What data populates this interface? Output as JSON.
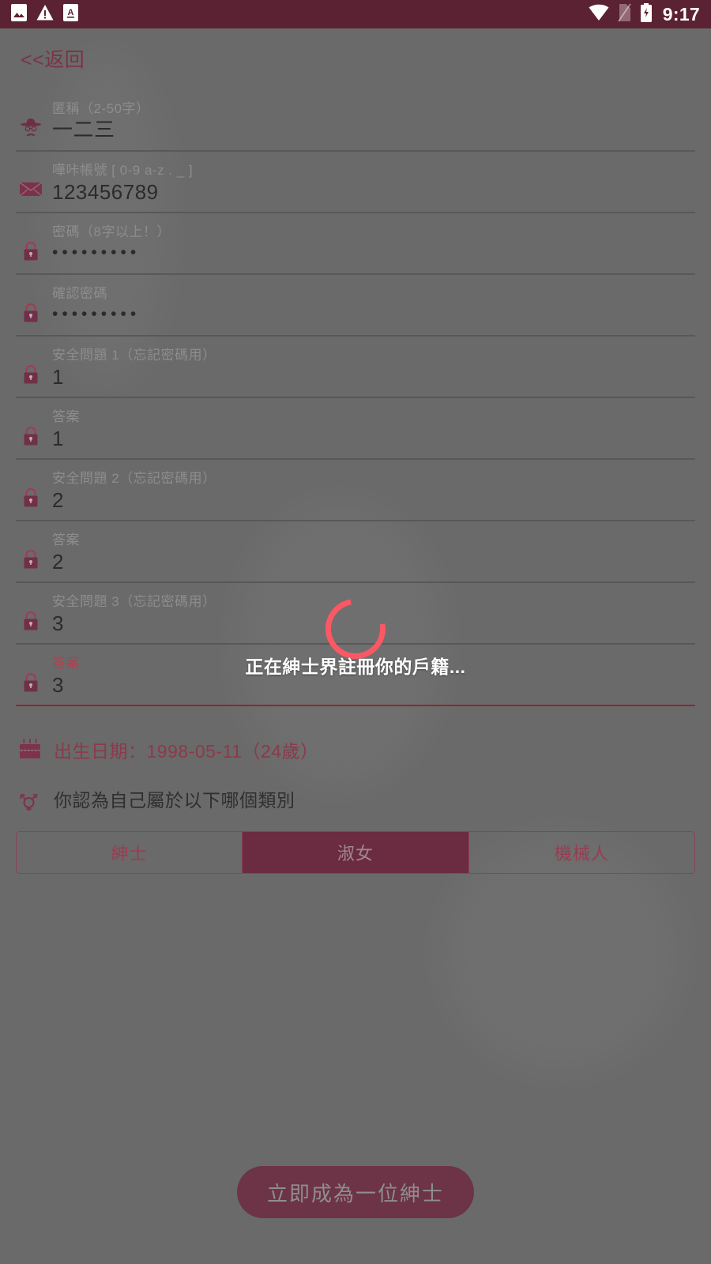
{
  "statusbar": {
    "time": "9:17",
    "left_icons": [
      "image-notification-icon",
      "warning-notification-icon",
      "a-badge-notification-icon"
    ],
    "right_icons": [
      "wifi-icon",
      "no-sim-icon",
      "battery-charging-icon"
    ],
    "bg_color": "#5b2233"
  },
  "nav": {
    "back_label": "<<返回"
  },
  "form": {
    "fields": [
      {
        "label": "匿稱（2-50字）",
        "value": "一二三",
        "icon": "gentleman-icon",
        "masked": false,
        "focused": false,
        "name": "nickname"
      },
      {
        "label": "嘩咔帳號 [ 0-9 a-z . _ ]",
        "value": "123456789",
        "icon": "envelope-icon",
        "masked": false,
        "focused": false,
        "name": "account"
      },
      {
        "label": "密碼（8字以上！）",
        "value": "•••••••••",
        "icon": "lock-icon",
        "masked": true,
        "focused": false,
        "name": "password"
      },
      {
        "label": "確認密碼",
        "value": "•••••••••",
        "icon": "lock-icon",
        "masked": true,
        "focused": false,
        "name": "confirm-password"
      },
      {
        "label": "安全問題 1（忘記密碼用）",
        "value": "1",
        "icon": "lock-icon",
        "masked": false,
        "focused": false,
        "name": "security-question-1"
      },
      {
        "label": "答案",
        "value": "1",
        "icon": "lock-icon",
        "masked": false,
        "focused": false,
        "name": "security-answer-1"
      },
      {
        "label": "安全問題 2（忘記密碼用）",
        "value": "2",
        "icon": "lock-icon",
        "masked": false,
        "focused": false,
        "name": "security-question-2"
      },
      {
        "label": "答案",
        "value": "2",
        "icon": "lock-icon",
        "masked": false,
        "focused": false,
        "name": "security-answer-2"
      },
      {
        "label": "安全問題 3（忘記密碼用）",
        "value": "3",
        "icon": "lock-icon",
        "masked": false,
        "focused": false,
        "name": "security-question-3"
      },
      {
        "label": "答案",
        "value": "3",
        "icon": "lock-icon",
        "masked": false,
        "focused": true,
        "name": "security-answer-3"
      }
    ],
    "birthday": {
      "icon": "birthday-cake-icon",
      "text": "出生日期：1998-05-11（24歲）"
    },
    "gender": {
      "icon": "transgender-icon",
      "question": "你認為自己屬於以下哪個類別",
      "options": [
        "紳士",
        "淑女",
        "機械人"
      ],
      "selected_index": 1
    },
    "submit_label": "立即成為一位紳士"
  },
  "overlay": {
    "message": "正在紳士界註冊你的戶籍...",
    "spinner_color": "#fb5864",
    "visible": true
  },
  "colors": {
    "brand_maroon": "#5b2233",
    "accent_pink": "#8a3a4c",
    "focus_red": "#b14050",
    "dim_backdrop": "#6a6a6a"
  }
}
